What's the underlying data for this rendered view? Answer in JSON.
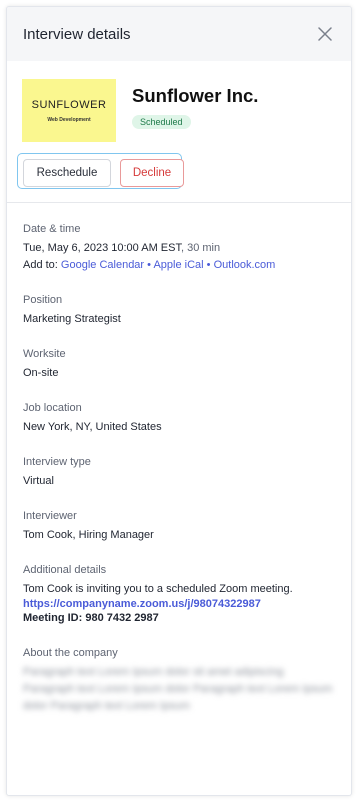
{
  "header": {
    "title": "Interview details",
    "close_icon": "close-icon"
  },
  "company": {
    "logo_name": "SUNFLOWER",
    "logo_sub": "Web Development",
    "name": "Sunflower Inc.",
    "status": "Scheduled"
  },
  "actions": {
    "reschedule": "Reschedule",
    "decline": "Decline"
  },
  "date": {
    "label": "Date & time",
    "datetime": "Tue, May 6, 2023 10:00 AM EST",
    "duration": ", 30 min",
    "add_to": "Add to:",
    "google": "Google Calendar",
    "apple": "Apple iCal",
    "outlook": "Outlook.com",
    "sep": "•"
  },
  "position": {
    "label": "Position",
    "value": "Marketing Strategist"
  },
  "worksite": {
    "label": "Worksite",
    "value": "On-site"
  },
  "job_location": {
    "label": "Job location",
    "value": "New York, NY, United States"
  },
  "interview_type": {
    "label": "Interview type",
    "value": "Virtual"
  },
  "interviewer": {
    "label": "Interviewer",
    "value": "Tom Cook, Hiring Manager"
  },
  "additional": {
    "label": "Additional details",
    "text": "Tom Cook is inviting you to a scheduled Zoom meeting.",
    "link": "https://companyname.zoom.us/j/98074322987",
    "meeting_id": "Meeting ID: 980 7432 2987"
  },
  "about": {
    "label": "About the company",
    "text": "Paragraph text Lorem Ipsum dolor sit amet adipiscing Paragraph text Lorem Ipsum dolor Paragraph text Lorem Ipsum dolor Paragraph text Lorem Ipsum"
  },
  "colors": {
    "accent": "#4a5bd8",
    "badge_bg": "#dff5e8",
    "badge_text": "#1f7a4a",
    "decline": "#d63a3a",
    "logo_bg": "#faf78f"
  }
}
